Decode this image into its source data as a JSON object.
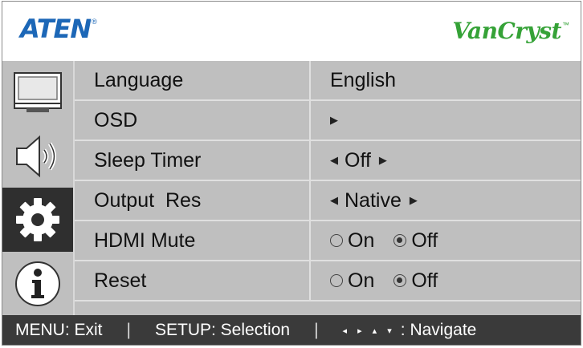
{
  "header": {
    "brand_logo": "ATEN",
    "brand_reg": "®",
    "product_logo": "VanCryst",
    "product_tm": "™",
    "colors": {
      "brand": "#1c67b7",
      "product": "#35a237"
    }
  },
  "sidebar": {
    "items": [
      {
        "name": "display",
        "icon": "monitor-icon",
        "selected": false
      },
      {
        "name": "audio",
        "icon": "speaker-icon",
        "selected": false
      },
      {
        "name": "setup",
        "icon": "gear-icon",
        "selected": true
      },
      {
        "name": "info",
        "icon": "info-icon",
        "selected": false
      }
    ]
  },
  "menu": {
    "rows": [
      {
        "label": "Language",
        "value": "English"
      },
      {
        "label": "OSD",
        "value": ""
      },
      {
        "label": "Sleep Timer",
        "value": "Off"
      },
      {
        "label": "Output  Res",
        "value": "Native"
      },
      {
        "label": "HDMI Mute",
        "options": [
          "On",
          "Off"
        ],
        "selected": "Off"
      },
      {
        "label": "Reset",
        "options": [
          "On",
          "Off"
        ],
        "selected": "Off"
      }
    ]
  },
  "footer": {
    "menu_hint": "MENU: Exit",
    "setup_hint": "SETUP: Selection",
    "separator": "|",
    "navigate_hint": ": Navigate",
    "nav_arrows": "◂ ▸ ▴ ▾"
  }
}
